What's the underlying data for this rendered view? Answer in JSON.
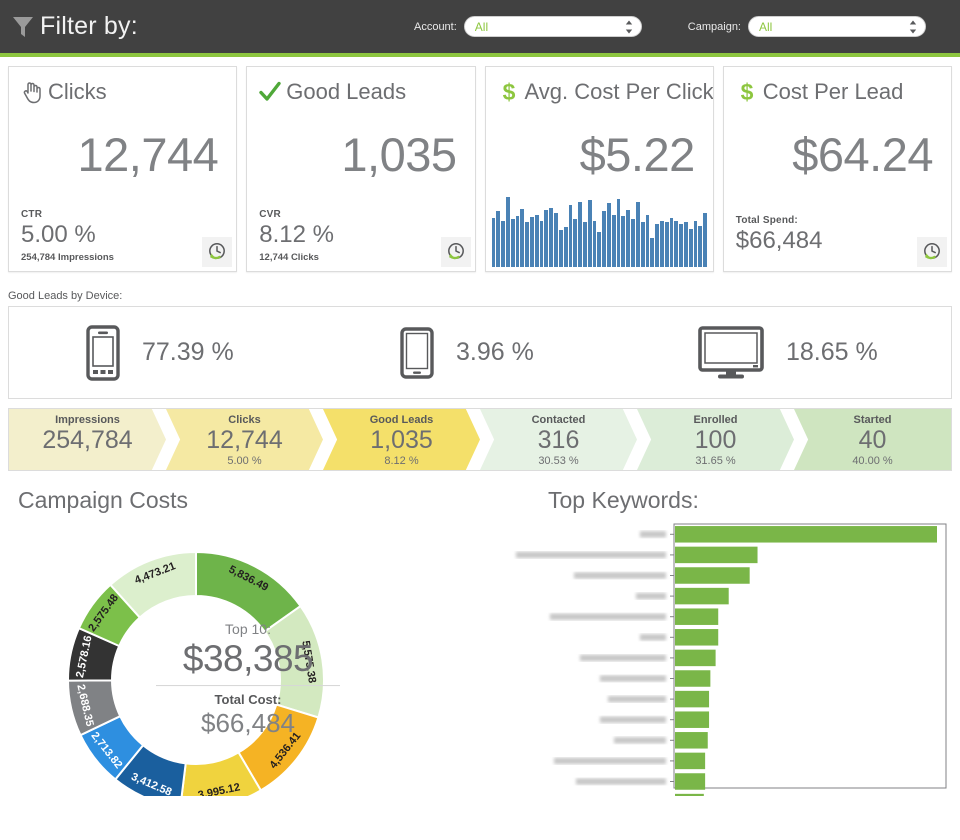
{
  "filter_bar": {
    "title": "Filter by:",
    "funnel_icon": "funnel-icon",
    "account": {
      "label": "Account:",
      "value": "All"
    },
    "campaign": {
      "label": "Campaign:",
      "value": "All"
    },
    "accent_color": "#8dc63f",
    "background_color": "#414141"
  },
  "kpi_cards": [
    {
      "icon": "click-hand-icon",
      "title": "Clicks",
      "value": "12,744",
      "sub_label": "CTR",
      "sub_value": "5.00 %",
      "note": "254,784 Impressions",
      "has_clock": true,
      "has_sparkline": false
    },
    {
      "icon": "check-icon",
      "title": "Good Leads",
      "value": "1,035",
      "sub_label": "CVR",
      "sub_value": "8.12 %",
      "note": "12,744 Clicks",
      "has_clock": true,
      "has_sparkline": false
    },
    {
      "icon": "dollar-icon",
      "title": "Avg. Cost Per Click",
      "value": "$5.22",
      "sub_label": "",
      "sub_value": "",
      "note": "",
      "has_clock": false,
      "has_sparkline": true
    },
    {
      "icon": "dollar-icon",
      "title": "Cost Per Lead",
      "value": "$64.24",
      "sub_label": "Total Spend:",
      "sub_value": "$66,484",
      "note": "",
      "has_clock": true,
      "has_sparkline": false
    }
  ],
  "sparkline": {
    "color": "#4a82b5",
    "values": [
      62,
      70,
      58,
      88,
      60,
      64,
      73,
      56,
      63,
      66,
      58,
      72,
      74,
      68,
      46,
      50,
      78,
      60,
      82,
      56,
      84,
      58,
      44,
      70,
      80,
      66,
      86,
      64,
      72,
      60,
      82,
      56,
      66,
      36,
      54,
      58,
      56,
      62,
      58,
      54,
      56,
      48,
      58,
      52,
      68
    ]
  },
  "devices": {
    "caption": "Good Leads by Device:",
    "items": [
      {
        "icon": "mobile-phone-icon",
        "percent": "77.39 %"
      },
      {
        "icon": "tablet-icon",
        "percent": "3.96 %"
      },
      {
        "icon": "desktop-monitor-icon",
        "percent": "18.65 %"
      }
    ]
  },
  "funnel": {
    "steps": [
      {
        "label": "Impressions",
        "value": "254,784",
        "percent": "",
        "color": "#f3efcc"
      },
      {
        "label": "Clicks",
        "value": "12,744",
        "percent": "5.00 %",
        "color": "#f5e9a3"
      },
      {
        "label": "Good Leads",
        "value": "1,035",
        "percent": "8.12 %",
        "color": "#f4e06a"
      },
      {
        "label": "Contacted",
        "value": "316",
        "percent": "30.53 %",
        "color": "#e6f2e4"
      },
      {
        "label": "Enrolled",
        "value": "100",
        "percent": "31.65 %",
        "color": "#dcedd8"
      },
      {
        "label": "Started",
        "value": "40",
        "percent": "40.00 %",
        "color": "#cfe5c0"
      }
    ]
  },
  "chart_data": [
    {
      "type": "pie",
      "name": "campaign-costs-donut",
      "title": "Campaign Costs",
      "center": {
        "top_label": "Top 10:",
        "top_value": "$38,385",
        "total_label": "Total Cost:",
        "total_value": "$66,484"
      },
      "labels": [
        "5,836.49",
        "5,575.38",
        "4,536.41",
        "3,995.12",
        "3,412.58",
        "2,713.82",
        "2,688.35",
        "2,578.16",
        "2,575.48",
        "4,473.21"
      ],
      "values": [
        5836.49,
        5575.38,
        4536.41,
        3995.12,
        3412.58,
        2713.82,
        2688.35,
        2578.16,
        2575.48,
        4473.21
      ],
      "colors": [
        "#6eb44a",
        "#d3e9c0",
        "#f5b324",
        "#f0d33e",
        "#1a5f9e",
        "#2e8fe0",
        "#808285",
        "#333333",
        "#7cc04a",
        "#dcefcd"
      ],
      "legend": "none"
    },
    {
      "type": "bar",
      "name": "top-keywords-bar-chart",
      "orientation": "horizontal",
      "title": "Top Keywords:",
      "labels_redacted": true,
      "categories": [
        "",
        "",
        "",
        "",
        "",
        "",
        "",
        "",
        "",
        "",
        "",
        "",
        "",
        ""
      ],
      "values": [
        100,
        31.5,
        28.5,
        20.5,
        16.5,
        16.5,
        15.5,
        13.5,
        13,
        13,
        12.5,
        11.5,
        11.5,
        11
      ],
      "bar_color": "#7ab648",
      "xlabel": "",
      "ylabel": "",
      "grid": false
    }
  ]
}
